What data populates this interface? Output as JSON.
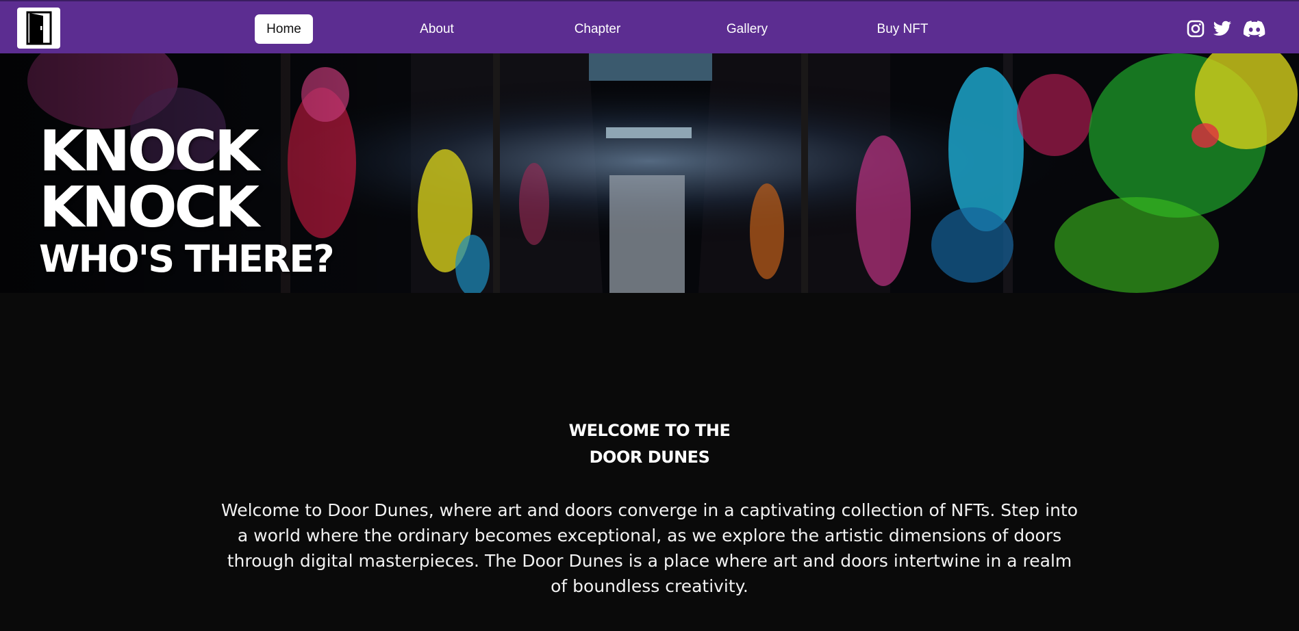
{
  "nav": {
    "items": [
      {
        "label": "Home",
        "active": true
      },
      {
        "label": "About",
        "active": false
      },
      {
        "label": "Chapter",
        "active": false
      },
      {
        "label": "Gallery",
        "active": false
      },
      {
        "label": "Buy NFT",
        "active": false
      }
    ],
    "social": [
      {
        "icon": "instagram-icon"
      },
      {
        "icon": "twitter-icon"
      },
      {
        "icon": "discord-icon"
      }
    ],
    "logo_icon": "door-icon",
    "colors": {
      "bar": "#5c2d91",
      "active_bg": "#ffffff"
    }
  },
  "hero": {
    "line1": "KNOCK",
    "line2": "KNOCK",
    "line3": "WHO'S THERE?"
  },
  "welcome": {
    "heading_line1": "WELCOME TO THE",
    "heading_line2": "DOOR DUNES",
    "body": "Welcome to Door Dunes, where art and doors converge in a captivating collection of NFTs. Step into a world where the ordinary becomes exceptional, as we explore the artistic dimensions of doors through digital masterpieces. The Door Dunes is a place where art and doors intertwine in a realm of boundless creativity."
  },
  "colors": {
    "page_bg": "#0a0a0a"
  }
}
